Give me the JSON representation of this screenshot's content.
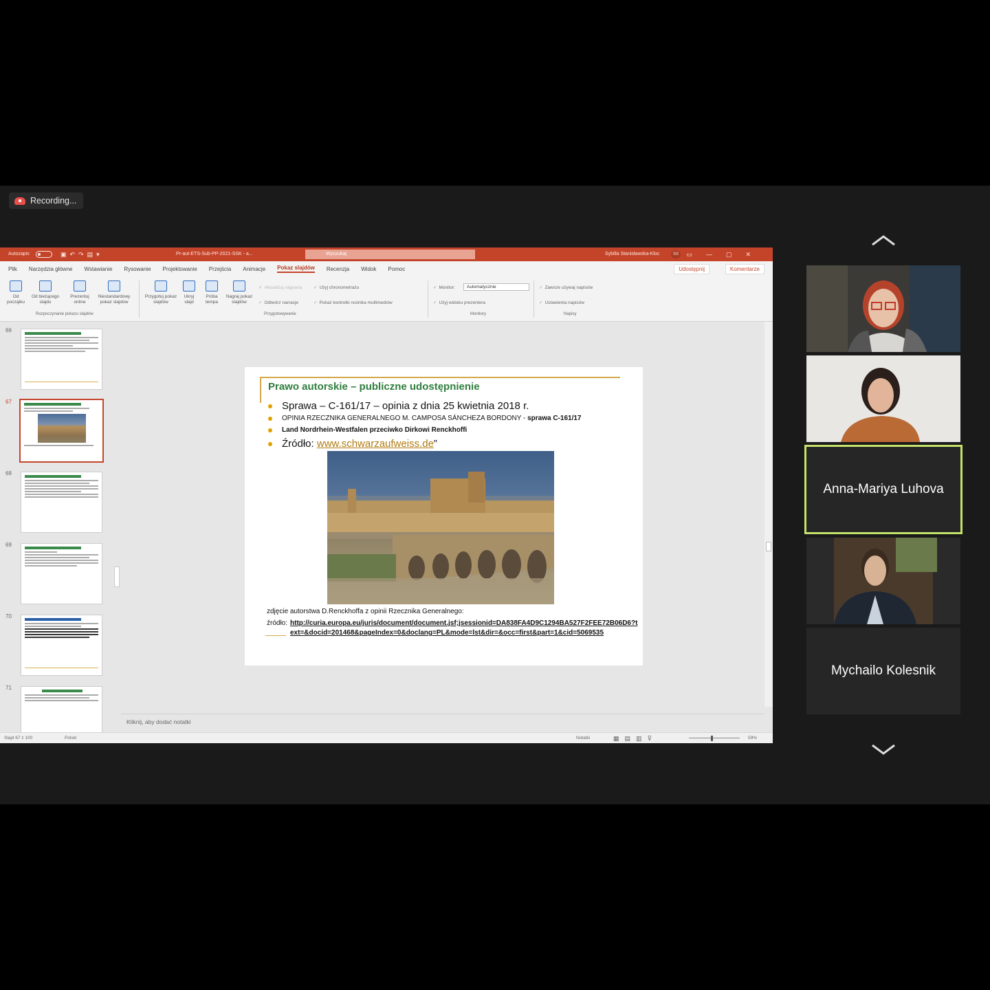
{
  "recording": {
    "label": "Recording..."
  },
  "ppt": {
    "titlebar": {
      "autosave": "Autozapis",
      "doc": "Pr-aut-ETS-Sub-PP-2021-SSK - a...",
      "search_placeholder": "Wyszukaj",
      "user": "Sybilla Stanisławska-Kloc",
      "user_initials": "SS"
    },
    "tabs": [
      "Plik",
      "Narzędzia główne",
      "Wstawianie",
      "Rysowanie",
      "Projektowanie",
      "Przejścia",
      "Animacje",
      "Pokaz slajdów",
      "Recenzja",
      "Widok",
      "Pomoc"
    ],
    "share": "Udostępnij",
    "comments": "Komentarze",
    "ribbon": {
      "btn_from_start": "Od początku",
      "btn_from_current": "Od bieżącego slajdu",
      "btn_present_online": "Prezentuj online",
      "btn_custom_show": "Niestandardowy pokaz slajdów",
      "group_start": "Rozpoczynanie pokazu slajdów",
      "btn_setup": "Przygotuj pokaz slajdów",
      "btn_hide": "Ukryj slajd",
      "btn_rehearse": "Próba tempa",
      "btn_record": "Nagraj pokaz slajdów",
      "chk_narration": "Odtwórz narracje",
      "chk_timings": "Użyj chronometrażu",
      "chk_media": "Pokaż kontrolki nośnika multimediów",
      "chk_rewrite": "Aktualizuj nagrania",
      "group_setup": "Przygotowywanie",
      "monitor_label": "Monitor:",
      "monitor_value": "Automatycznie",
      "chk_presenter": "Użyj widoku prezentera",
      "group_monitors": "Monitory",
      "chk_subtitles": "Zawsze używaj napisów",
      "subtitle_settings": "Ustawienia napisów",
      "group_captions": "Napisy"
    },
    "thumbnails": [
      {
        "num": "66"
      },
      {
        "num": "67"
      },
      {
        "num": "68"
      },
      {
        "num": "69"
      },
      {
        "num": "70"
      },
      {
        "num": "71"
      }
    ],
    "slide": {
      "title": "Prawo autorskie – publiczne udostępnienie",
      "bullet1": "Sprawa – C-161/17 – opinia z dnia 25 kwietnia 2018 r.",
      "bullet2_a": "OPINIA RZECZNIKA GENERALNEGO M. CAMPOSA SÁNCHEZA BORDONY - ",
      "bullet2_b": "sprawa C-161/17",
      "bullet3": "Land Nordrhein-Westfalen przeciwko Dirkowi Renckhoffi",
      "bullet4_label": "Źródło: ",
      "bullet4_link": "www.schwarzaufweiss.de",
      "bullet4_end": "”",
      "caption": "zdjęcie autorstwa D.Renckhoffa z opinii Rzecznika Generalnego:",
      "src_label": "źródło:",
      "src_url": "http://curia.europa.eu/juris/document/document.jsf;jsessionid=DA838FA4D9C1294BA527F2FEE72B06D6?text=&docid=201468&pageIndex=0&doclang=PL&mode=lst&dir=&occ=first&part=1&cid=5069535"
    },
    "notes_placeholder": "Kliknij, aby dodać notatki",
    "status": {
      "slide_pos": "Slajd 67 z 100",
      "lang": "Polski",
      "notes": "Notatki",
      "zoom": "59%"
    }
  },
  "participants": [
    {
      "name": "",
      "video": true
    },
    {
      "name": "",
      "video": true
    },
    {
      "name": "Anna-Mariya Luhova",
      "video": false,
      "active": true
    },
    {
      "name": "",
      "video": true
    },
    {
      "name": "Mychailo Kolesnik",
      "video": false
    }
  ],
  "colors": {
    "accent_ppt": "#c4442a",
    "speaker_border": "#c5e26a",
    "slide_title": "#2e7d3c"
  }
}
